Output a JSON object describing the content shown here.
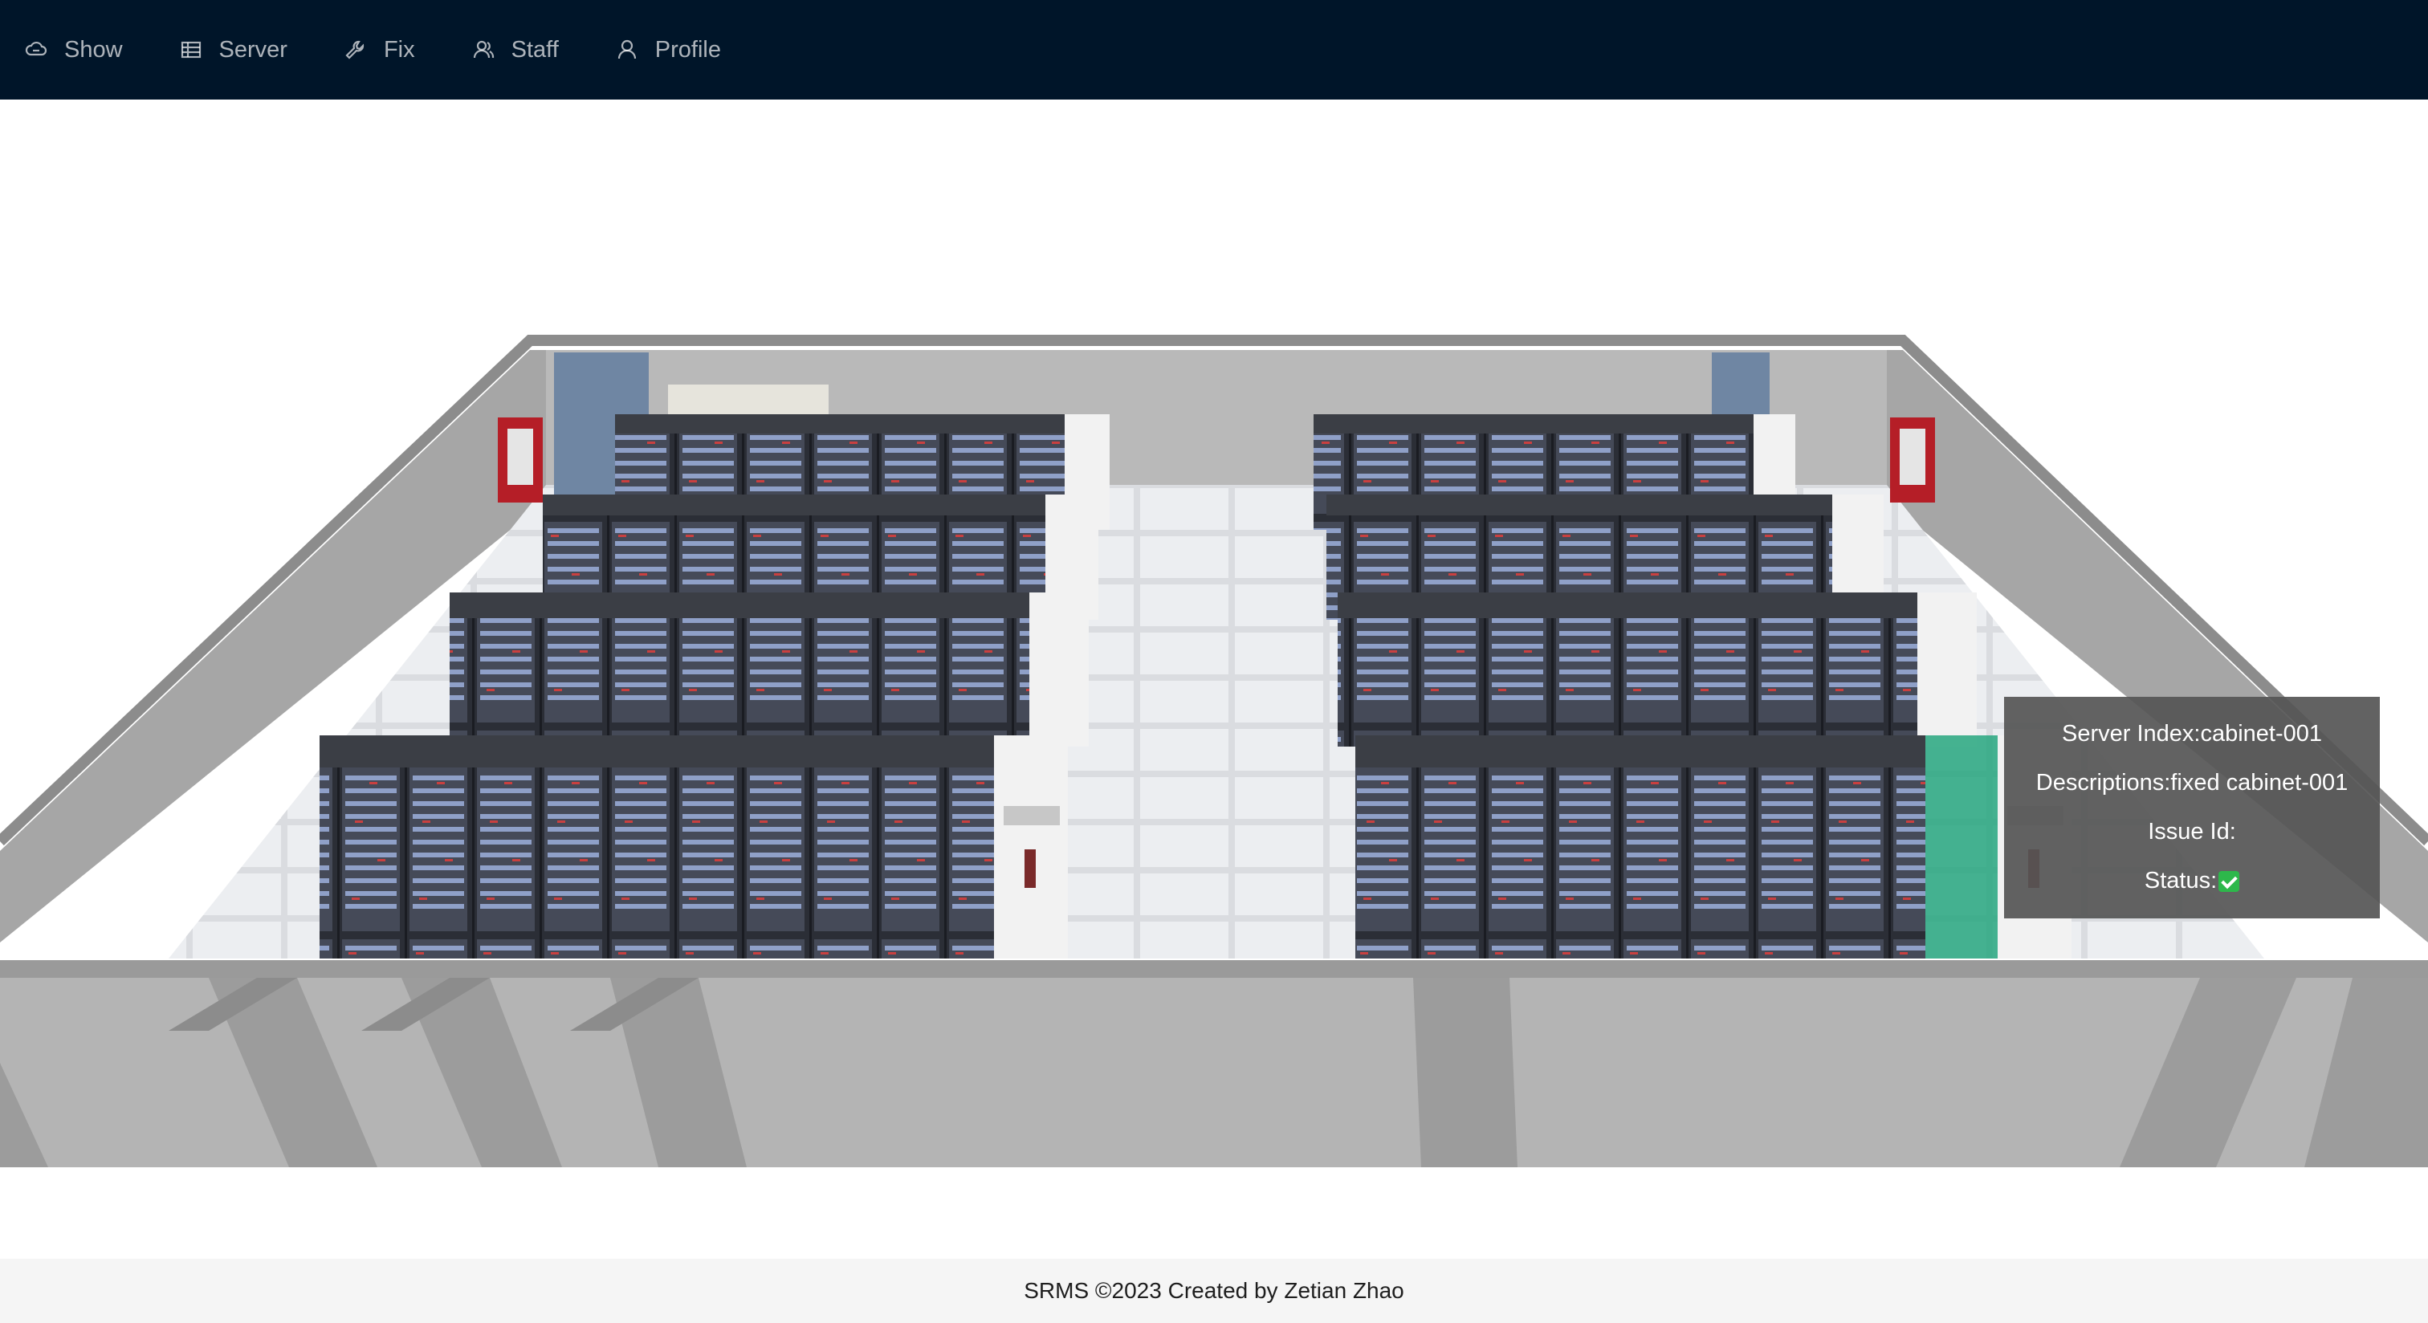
{
  "nav": {
    "items": [
      {
        "label": "Show",
        "icon": "cloud-icon"
      },
      {
        "label": "Server",
        "icon": "table-icon"
      },
      {
        "label": "Fix",
        "icon": "wrench-icon"
      },
      {
        "label": "Staff",
        "icon": "team-icon"
      },
      {
        "label": "Profile",
        "icon": "user-icon"
      }
    ]
  },
  "tooltip": {
    "server_index": "Server Index:cabinet-001",
    "descriptions": "Descriptions:fixed cabinet-001",
    "issue_id": "Issue Id:",
    "status": "Status:"
  },
  "footer": {
    "text": "SRMS ©2023 Created by Zetian Zhao"
  },
  "colors": {
    "nav_bg": "#001529",
    "selected_cabinet": "#1fa37a",
    "status_ok": "#2db84b"
  }
}
